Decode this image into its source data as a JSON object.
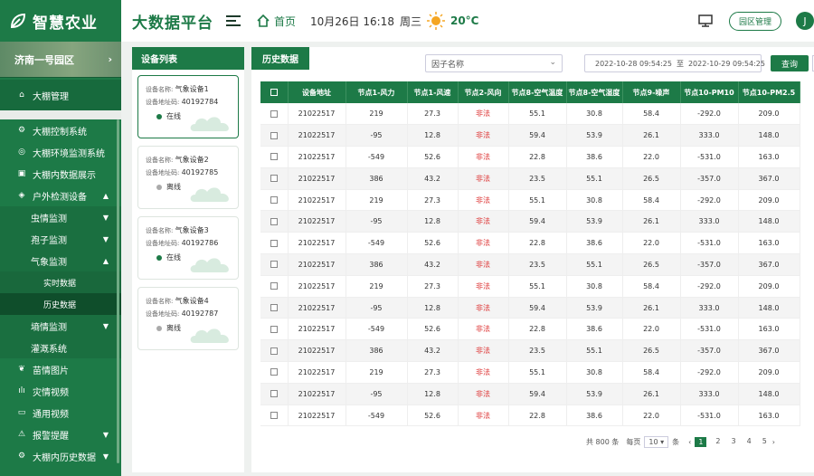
{
  "header": {
    "brand": "智慧农业",
    "platform": "大数据平台",
    "home": "首页",
    "datetime": "10月26日 16:18",
    "weekday": "周三",
    "temperature": "20°C",
    "park_manage": "园区管理",
    "user_initial": "J"
  },
  "sidebar": {
    "park": "济南一号园区",
    "items": [
      {
        "label": "大棚管理",
        "icon": "home-icon"
      },
      {
        "label": "大棚控制系统",
        "icon": "gear-icon"
      },
      {
        "label": "大棚环境监测系统",
        "icon": "monitor-icon"
      },
      {
        "label": "大棚内数据展示",
        "icon": "chart-icon"
      },
      {
        "label": "户外检测设备",
        "icon": "pin-icon"
      },
      {
        "label": "虫情监测"
      },
      {
        "label": "孢子监测"
      },
      {
        "label": "气象监测"
      },
      {
        "label": "实时数据"
      },
      {
        "label": "历史数据"
      },
      {
        "label": "墒情监测"
      },
      {
        "label": "灌溉系统"
      },
      {
        "label": "苗情图片",
        "icon": "leaf-icon"
      },
      {
        "label": "灾情视频",
        "icon": "bar-icon"
      },
      {
        "label": "通用视频",
        "icon": "video-icon"
      },
      {
        "label": "报警提醒",
        "icon": "warning-icon"
      },
      {
        "label": "大棚内历史数据",
        "icon": "settings-icon"
      }
    ]
  },
  "devices": {
    "title": "设备列表",
    "name_label": "设备名称:",
    "addr_label": "设备地址码:",
    "list": [
      {
        "name": "气象设备1",
        "addr": "40192784",
        "status": "在线"
      },
      {
        "name": "气象设备2",
        "addr": "40192785",
        "status": "离线"
      },
      {
        "name": "气象设备3",
        "addr": "40192786",
        "status": "在线"
      },
      {
        "name": "气象设备4",
        "addr": "40192787",
        "status": "离线"
      }
    ]
  },
  "main": {
    "tab": "历史数据",
    "factor_placeholder": "因子名称",
    "date_start": "2022-10-28 09:54:25",
    "date_to": "至",
    "date_end": "2022-10-29 09:54:25",
    "query": "查询",
    "columns": [
      "设备地址",
      "节点1-风力",
      "节点1-风速",
      "节点2-风向",
      "节点8-空气温度",
      "节点8-空气湿度",
      "节点9-噪声",
      "节点10-PM10",
      "节点10-PM2.5"
    ],
    "rows": [
      [
        "21022517",
        "219",
        "27.3",
        "非法",
        "55.1",
        "30.8",
        "58.4",
        "-292.0",
        "209.0"
      ],
      [
        "21022517",
        "-95",
        "12.8",
        "非法",
        "59.4",
        "53.9",
        "26.1",
        "333.0",
        "148.0"
      ],
      [
        "21022517",
        "-549",
        "52.6",
        "非法",
        "22.8",
        "38.6",
        "22.0",
        "-531.0",
        "163.0"
      ],
      [
        "21022517",
        "386",
        "43.2",
        "非法",
        "23.5",
        "55.1",
        "26.5",
        "-357.0",
        "367.0"
      ],
      [
        "21022517",
        "219",
        "27.3",
        "非法",
        "55.1",
        "30.8",
        "58.4",
        "-292.0",
        "209.0"
      ],
      [
        "21022517",
        "-95",
        "12.8",
        "非法",
        "59.4",
        "53.9",
        "26.1",
        "333.0",
        "148.0"
      ],
      [
        "21022517",
        "-549",
        "52.6",
        "非法",
        "22.8",
        "38.6",
        "22.0",
        "-531.0",
        "163.0"
      ],
      [
        "21022517",
        "386",
        "43.2",
        "非法",
        "23.5",
        "55.1",
        "26.5",
        "-357.0",
        "367.0"
      ],
      [
        "21022517",
        "219",
        "27.3",
        "非法",
        "55.1",
        "30.8",
        "58.4",
        "-292.0",
        "209.0"
      ],
      [
        "21022517",
        "-95",
        "12.8",
        "非法",
        "59.4",
        "53.9",
        "26.1",
        "333.0",
        "148.0"
      ],
      [
        "21022517",
        "-549",
        "52.6",
        "非法",
        "22.8",
        "38.6",
        "22.0",
        "-531.0",
        "163.0"
      ],
      [
        "21022517",
        "386",
        "43.2",
        "非法",
        "23.5",
        "55.1",
        "26.5",
        "-357.0",
        "367.0"
      ],
      [
        "21022517",
        "219",
        "27.3",
        "非法",
        "55.1",
        "30.8",
        "58.4",
        "-292.0",
        "209.0"
      ],
      [
        "21022517",
        "-95",
        "12.8",
        "非法",
        "59.4",
        "53.9",
        "26.1",
        "333.0",
        "148.0"
      ],
      [
        "21022517",
        "-549",
        "52.6",
        "非法",
        "22.8",
        "38.6",
        "22.0",
        "-531.0",
        "163.0"
      ]
    ],
    "pager": {
      "total": "共 800 条",
      "per_page_label": "每页",
      "per_page": "10",
      "unit": "条",
      "pages": [
        "1",
        "2",
        "3",
        "4",
        "5"
      ]
    }
  },
  "colors": {
    "brand": "#1d7a47",
    "online": "#1d7a47",
    "offline": "#aaaaaa",
    "illegal": "#dd3333"
  }
}
